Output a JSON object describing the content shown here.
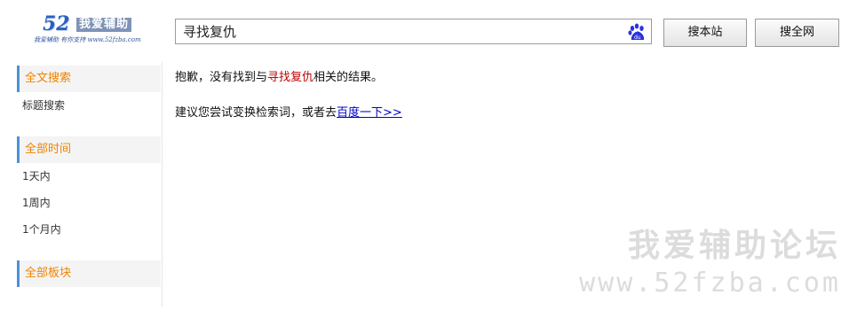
{
  "logo": {
    "number": "52",
    "name": "我爱辅助",
    "subtitle": "我爱辅助 有你支持 www.52fzba.com"
  },
  "search": {
    "value": "寻找复仇",
    "icon": "baidu-paw-icon"
  },
  "buttons": {
    "search_site": "搜本站",
    "search_web": "搜全网"
  },
  "sidebar": {
    "sections": [
      {
        "heading": "全文搜索",
        "items": [
          "标题搜索"
        ]
      },
      {
        "heading": "全部时间",
        "items": [
          "1天内",
          "1周内",
          "1个月内"
        ]
      },
      {
        "heading": "全部板块",
        "items": []
      }
    ]
  },
  "result": {
    "sorry_prefix": "抱歉，没有找到与",
    "keyword": "寻找复仇",
    "sorry_suffix": "相关的结果。",
    "suggest_prefix": "建议您尝试变换检索词，或者去",
    "suggest_link": "百度一下>>"
  },
  "watermark": {
    "line1": "我爱辅助论坛",
    "line2": "www.52fzba.com"
  },
  "colors": {
    "accent_orange": "#f08300",
    "sidebar_bar": "#4c92d6",
    "keyword_red": "#c00000",
    "link_blue": "#0000cc"
  }
}
